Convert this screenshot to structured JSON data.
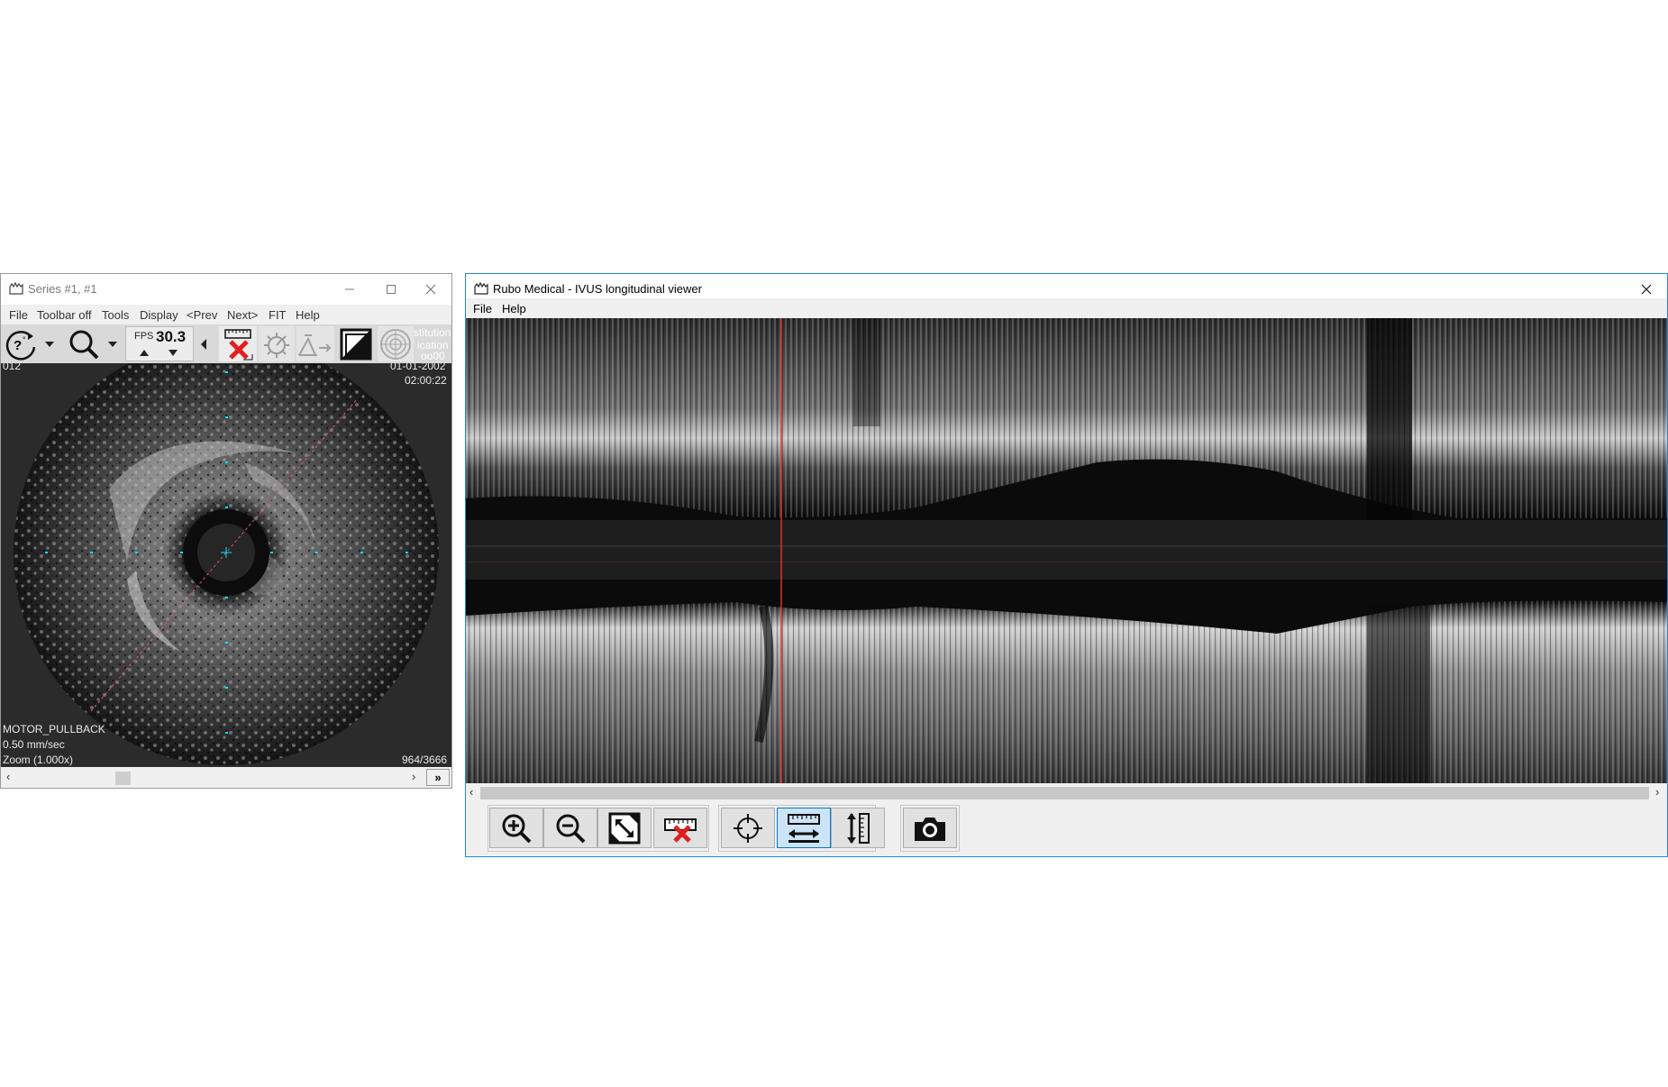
{
  "series_window": {
    "title": "Series #1, #1",
    "menu": [
      "File",
      "Toolbar off",
      "Tools",
      "Display",
      "<Prev",
      "Next>",
      "FIT",
      "Help"
    ],
    "fps_label": "FPS",
    "fps_value": "30.3",
    "overlay": {
      "institution_1": "stitution",
      "institution_2": "ication",
      "institution_3": "oo00",
      "date": "01-01-2002",
      "time": "02:00:22",
      "left_top": "012",
      "mode": "MOTOR_PULLBACK",
      "speed": "0.50 mm/sec",
      "zoom": "Zoom (1.000x)",
      "frame": "964/3666"
    },
    "icons": [
      "rotate-help-icon",
      "magnifier-icon",
      "measure-delete-icon",
      "brightness-icon",
      "filter-icon",
      "invert-icon",
      "grid-icon"
    ]
  },
  "longitudinal_window": {
    "title": "Rubo Medical - IVUS longitudinal viewer",
    "menu": [
      "File",
      "Help"
    ],
    "toolbar": [
      "zoom-in-icon",
      "zoom-out-icon",
      "fit-icon",
      "clear-measure-icon",
      "crosshair-icon",
      "horizontal-measure-icon",
      "vertical-measure-icon",
      "camera-icon"
    ],
    "active_tool": "horizontal-measure-icon"
  },
  "colors": {
    "accent_border": "#1e88e5",
    "cursor_line": "#e03030",
    "active_button": "#cce4f7"
  }
}
